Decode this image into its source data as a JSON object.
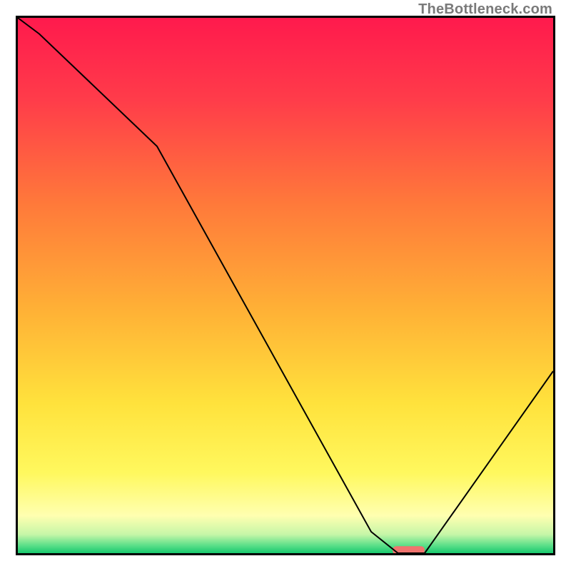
{
  "watermark": "TheBottleneck.com",
  "chart_data": {
    "type": "line",
    "title": "",
    "xlabel": "",
    "ylabel": "",
    "xlim": [
      0,
      100
    ],
    "ylim": [
      0,
      100
    ],
    "grid": false,
    "legend": null,
    "series": [
      {
        "name": "bottleneck-curve",
        "x": [
          0,
          4,
          26,
          66,
          71,
          76,
          100
        ],
        "y": [
          100,
          97,
          76,
          4,
          0,
          0,
          34
        ]
      }
    ],
    "marker": {
      "name": "current-selection",
      "x_range": [
        70,
        76
      ],
      "y": 0,
      "color": "#f0736e"
    },
    "background_gradient": {
      "orientation": "vertical",
      "stops": [
        {
          "pos": 0.0,
          "color": "#ff1a4d"
        },
        {
          "pos": 0.15,
          "color": "#ff3b4a"
        },
        {
          "pos": 0.35,
          "color": "#ff7a3a"
        },
        {
          "pos": 0.55,
          "color": "#ffb236"
        },
        {
          "pos": 0.72,
          "color": "#ffe23c"
        },
        {
          "pos": 0.85,
          "color": "#fff85e"
        },
        {
          "pos": 0.93,
          "color": "#ffffb0"
        },
        {
          "pos": 0.965,
          "color": "#c6f6a8"
        },
        {
          "pos": 0.985,
          "color": "#5ee08a"
        },
        {
          "pos": 1.0,
          "color": "#18c96e"
        }
      ]
    }
  }
}
